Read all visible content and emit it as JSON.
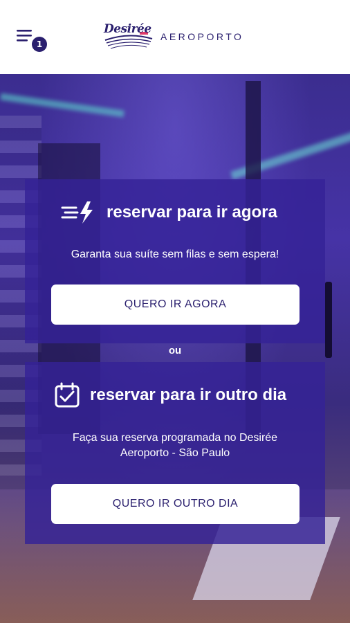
{
  "header": {
    "notification_count": "1",
    "brand_logo_text": "Desirée",
    "brand_name": "AEROPORTO"
  },
  "now_card": {
    "title": "reservar para ir agora",
    "description": "Garanta sua suíte sem filas e sem espera!",
    "button_label": "QUERO IR AGORA",
    "icon": "fast-bolt-icon"
  },
  "separator": "ou",
  "later_card": {
    "title": "reservar para ir outro dia",
    "description": "Faça sua reserva programada no Desirée Aeroporto - São Paulo",
    "button_label": "QUERO IR OUTRO DIA",
    "icon": "calendar-check-icon"
  },
  "colors": {
    "brand": "#2a1f6e",
    "card_overlay": "#3422962d",
    "button_bg": "#ffffff"
  }
}
